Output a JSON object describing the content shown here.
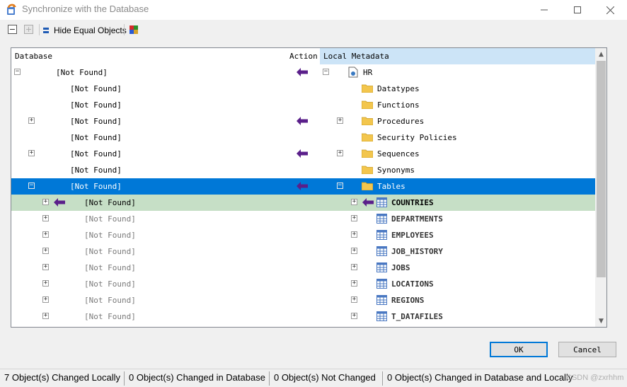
{
  "window": {
    "title": "Synchronize with the Database"
  },
  "toolbar": {
    "hide_equal_label": "Hide Equal Objects"
  },
  "columns": {
    "database": "Database",
    "action": "Action",
    "local": "Local Metadata"
  },
  "rows": [
    {
      "db": "[Not Found]",
      "local": "HR"
    },
    {
      "db": "[Not Found]",
      "local": "Datatypes"
    },
    {
      "db": "[Not Found]",
      "local": "Functions"
    },
    {
      "db": "[Not Found]",
      "local": "Procedures"
    },
    {
      "db": "[Not Found]",
      "local": "Security Policies"
    },
    {
      "db": "[Not Found]",
      "local": "Sequences"
    },
    {
      "db": "[Not Found]",
      "local": "Synonyms"
    },
    {
      "db": "[Not Found]",
      "local": "Tables"
    },
    {
      "db": "[Not Found]",
      "local": "COUNTRIES"
    },
    {
      "db": "[Not Found]",
      "local": "DEPARTMENTS"
    },
    {
      "db": "[Not Found]",
      "local": "EMPLOYEES"
    },
    {
      "db": "[Not Found]",
      "local": "JOB_HISTORY"
    },
    {
      "db": "[Not Found]",
      "local": "JOBS"
    },
    {
      "db": "[Not Found]",
      "local": "LOCATIONS"
    },
    {
      "db": "[Not Found]",
      "local": "REGIONS"
    },
    {
      "db": "[Not Found]",
      "local": "T_DATAFILES"
    }
  ],
  "buttons": {
    "ok": "OK",
    "cancel": "Cancel"
  },
  "status": {
    "changed_locally": "7 Object(s) Changed Locally",
    "changed_db": "0 Object(s) Changed in Database",
    "not_changed": "0 Object(s) Not Changed",
    "changed_both": "0 Object(s) Changed in Database and Locally",
    "watermark": "CSDN @zxrhhm"
  },
  "colors": {
    "selection": "#0078d7",
    "highlight_row": "#c6dfc6",
    "arrow": "#5a1f8a",
    "header_local": "#cce4f7"
  }
}
